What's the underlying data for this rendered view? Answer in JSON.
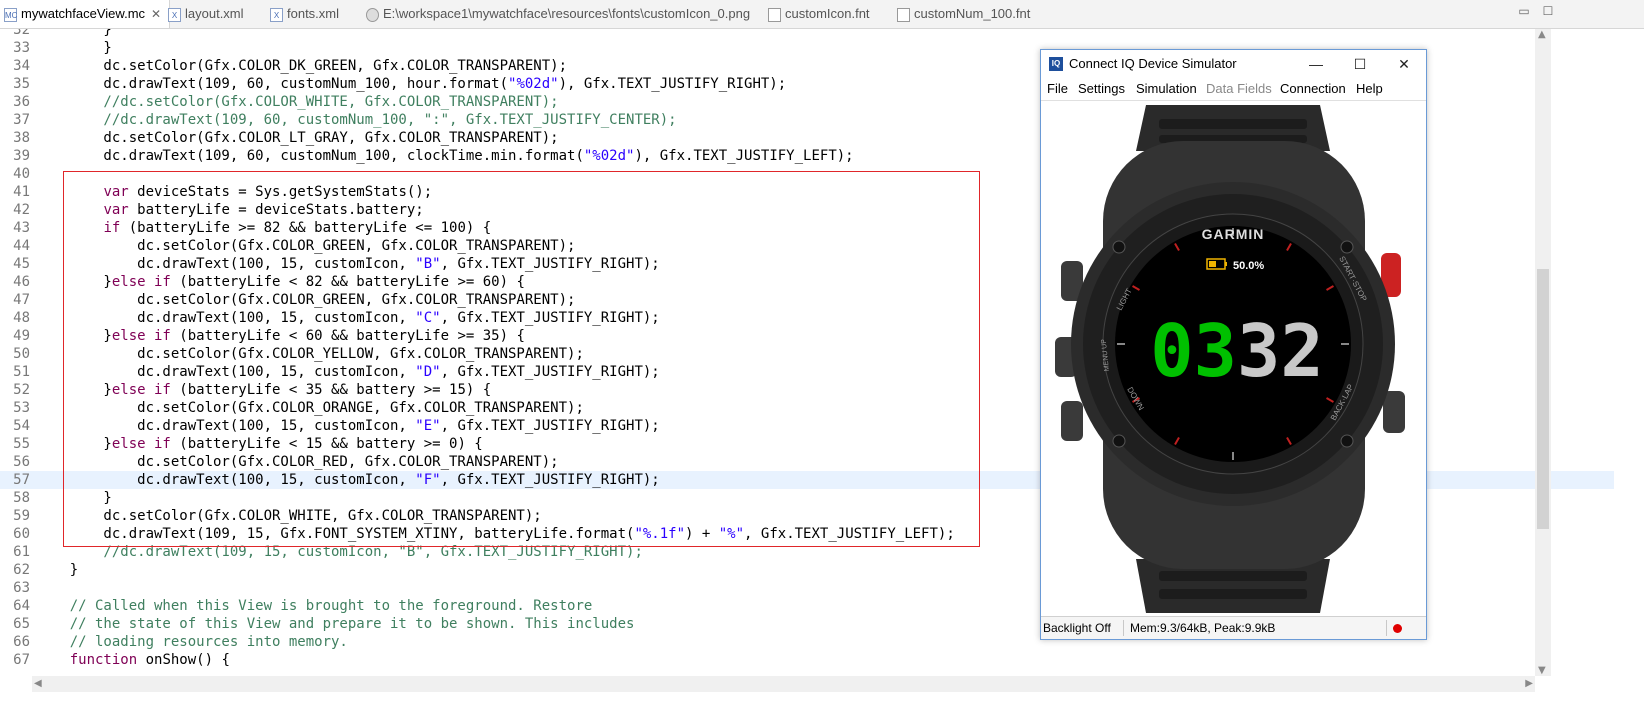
{
  "tabs": [
    {
      "label": "mywatchfaceView.mc",
      "icon": "monkeyc-file-icon",
      "active": true,
      "close": "✕"
    },
    {
      "label": "layout.xml",
      "icon": "xml-file-icon"
    },
    {
      "label": "fonts.xml",
      "icon": "xml-file-icon"
    },
    {
      "label": "E:\\workspace1\\mywatchface\\resources\\fonts\\customIcon_0.png",
      "icon": "image-file-icon"
    },
    {
      "label": "customIcon.fnt",
      "icon": "text-file-icon"
    },
    {
      "label": "customNum_100.fnt",
      "icon": "text-file-icon"
    }
  ],
  "editor": {
    "line_numbers": [
      "32",
      "33",
      "34",
      "35",
      "36",
      "37",
      "38",
      "39",
      "40",
      "41",
      "42",
      "43",
      "44",
      "45",
      "46",
      "47",
      "48",
      "49",
      "50",
      "51",
      "52",
      "53",
      "54",
      "55",
      "56",
      "57",
      "58",
      "59",
      "60",
      "61",
      "62",
      "63",
      "64",
      "65",
      "66",
      "67"
    ],
    "lines": [
      [
        [
          "p",
          "        }"
        ]
      ],
      [
        [
          "p",
          "        }"
        ]
      ],
      [
        [
          "p",
          "        dc.setColor(Gfx.COLOR_DK_GREEN, Gfx.COLOR_TRANSPARENT);"
        ]
      ],
      [
        [
          "p",
          "        dc.drawText(109, 60, customNum_100, hour.format("
        ],
        [
          "s",
          "\"%02d\""
        ],
        [
          "p",
          "), Gfx.TEXT_JUSTIFY_RIGHT);"
        ]
      ],
      [
        [
          "c",
          "        //dc.setColor(Gfx.COLOR_WHITE, Gfx.COLOR_TRANSPARENT);"
        ]
      ],
      [
        [
          "c",
          "        //dc.drawText(109, 60, customNum_100, \":\", Gfx.TEXT_JUSTIFY_CENTER);"
        ]
      ],
      [
        [
          "p",
          "        dc.setColor(Gfx.COLOR_LT_GRAY, Gfx.COLOR_TRANSPARENT);"
        ]
      ],
      [
        [
          "p",
          "        dc.drawText(109, 60, customNum_100, clockTime.min.format("
        ],
        [
          "s",
          "\"%02d\""
        ],
        [
          "p",
          "), Gfx.TEXT_JUSTIFY_LEFT);"
        ]
      ],
      [
        [
          "p",
          ""
        ]
      ],
      [
        [
          "p",
          "        "
        ],
        [
          "k",
          "var"
        ],
        [
          "p",
          " deviceStats = Sys.getSystemStats();"
        ]
      ],
      [
        [
          "p",
          "        "
        ],
        [
          "k",
          "var"
        ],
        [
          "p",
          " batteryLife = deviceStats.battery;"
        ]
      ],
      [
        [
          "p",
          "        "
        ],
        [
          "k",
          "if"
        ],
        [
          "p",
          " (batteryLife >= 82 && batteryLife <= 100) {"
        ]
      ],
      [
        [
          "p",
          "            dc.setColor(Gfx.COLOR_GREEN, Gfx.COLOR_TRANSPARENT);"
        ]
      ],
      [
        [
          "p",
          "            dc.drawText(100, 15, customIcon, "
        ],
        [
          "s",
          "\"B\""
        ],
        [
          "p",
          ", Gfx.TEXT_JUSTIFY_RIGHT);"
        ]
      ],
      [
        [
          "p",
          "        }"
        ],
        [
          "k",
          "else if"
        ],
        [
          "p",
          " (batteryLife < 82 && batteryLife >= 60) {"
        ]
      ],
      [
        [
          "p",
          "            dc.setColor(Gfx.COLOR_GREEN, Gfx.COLOR_TRANSPARENT);"
        ]
      ],
      [
        [
          "p",
          "            dc.drawText(100, 15, customIcon, "
        ],
        [
          "s",
          "\"C\""
        ],
        [
          "p",
          ", Gfx.TEXT_JUSTIFY_RIGHT);"
        ]
      ],
      [
        [
          "p",
          "        }"
        ],
        [
          "k",
          "else if"
        ],
        [
          "p",
          " (batteryLife < 60 && batteryLife >= 35) {"
        ]
      ],
      [
        [
          "p",
          "            dc.setColor(Gfx.COLOR_YELLOW, Gfx.COLOR_TRANSPARENT);"
        ]
      ],
      [
        [
          "p",
          "            dc.drawText(100, 15, customIcon, "
        ],
        [
          "s",
          "\"D\""
        ],
        [
          "p",
          ", Gfx.TEXT_JUSTIFY_RIGHT);"
        ]
      ],
      [
        [
          "p",
          "        }"
        ],
        [
          "k",
          "else if"
        ],
        [
          "p",
          " (batteryLife < 35 && battery >= 15) {"
        ]
      ],
      [
        [
          "p",
          "            dc.setColor(Gfx.COLOR_ORANGE, Gfx.COLOR_TRANSPARENT);"
        ]
      ],
      [
        [
          "p",
          "            dc.drawText(100, 15, customIcon, "
        ],
        [
          "s",
          "\"E\""
        ],
        [
          "p",
          ", Gfx.TEXT_JUSTIFY_RIGHT);"
        ]
      ],
      [
        [
          "p",
          "        }"
        ],
        [
          "k",
          "else if"
        ],
        [
          "p",
          " (batteryLife < 15 && battery >= 0) {"
        ]
      ],
      [
        [
          "p",
          "            dc.setColor(Gfx.COLOR_RED, Gfx.COLOR_TRANSPARENT);"
        ]
      ],
      [
        [
          "p",
          "            dc.drawText(100, 15, customIcon, "
        ],
        [
          "s",
          "\"F\""
        ],
        [
          "p",
          ", Gfx.TEXT_JUSTIFY_RIGHT);"
        ]
      ],
      [
        [
          "p",
          "        }"
        ]
      ],
      [
        [
          "p",
          "        dc.setColor(Gfx.COLOR_WHITE, Gfx.COLOR_TRANSPARENT);"
        ]
      ],
      [
        [
          "p",
          "        dc.drawText(109, 15, Gfx.FONT_SYSTEM_XTINY, batteryLife.format("
        ],
        [
          "s",
          "\"%.1f\""
        ],
        [
          "p",
          ") + "
        ],
        [
          "s",
          "\"%\""
        ],
        [
          "p",
          ", Gfx.TEXT_JUSTIFY_LEFT);"
        ]
      ],
      [
        [
          "c",
          "        //dc.drawText(109, 15, customIcon, \"B\", Gfx.TEXT_JUSTIFY_RIGHT);"
        ]
      ],
      [
        [
          "p",
          "    }"
        ]
      ],
      [
        [
          "p",
          ""
        ]
      ],
      [
        [
          "c",
          "    // Called when this View is brought to the foreground. Restore"
        ]
      ],
      [
        [
          "c",
          "    // the state of this View and prepare it to be shown. This includes"
        ]
      ],
      [
        [
          "c",
          "    // loading resources into memory."
        ]
      ],
      [
        [
          "p",
          "    "
        ],
        [
          "k",
          "function"
        ],
        [
          "p",
          " onShow() {"
        ]
      ]
    ],
    "highlighted_line": 25
  },
  "simulator": {
    "title": "Connect IQ Device Simulator",
    "logo_text": "IQ",
    "controls": {
      "minimize": "—",
      "maximize": "☐",
      "close": "✕"
    },
    "menu": [
      {
        "label": "File",
        "enabled": true
      },
      {
        "label": "Settings",
        "enabled": true
      },
      {
        "label": "Simulation",
        "enabled": true
      },
      {
        "label": "Data Fields",
        "enabled": false
      },
      {
        "label": "Connection",
        "enabled": true
      },
      {
        "label": "Help",
        "enabled": true
      }
    ],
    "watch": {
      "brand": "GARMIN",
      "bezel_labels": {
        "light": "LIGHT",
        "menu_up": "MENU UP",
        "down": "DOWN",
        "start_stop": "START·STOP",
        "back_lap": "BACK·LAP"
      },
      "battery_text": "50.0%",
      "battery_fraction": 0.5,
      "hour": "03",
      "minute": "32",
      "hour_color": "#00c000",
      "minute_color": "#c8c8c8",
      "battery_color": "#f0b400"
    },
    "status": {
      "backlight": "Backlight Off",
      "memory": "Mem:9.3/64kB, Peak:9.9kB"
    }
  },
  "window_controls": {
    "restore": "▭",
    "maximize": "☐"
  }
}
